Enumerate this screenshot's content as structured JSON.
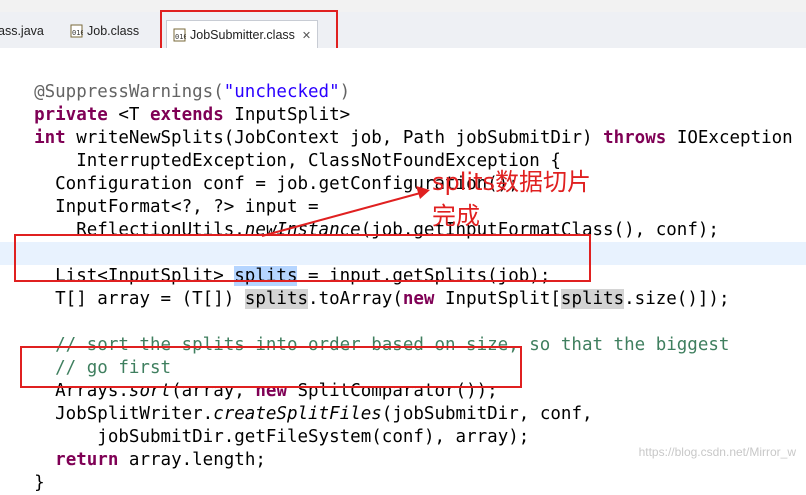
{
  "tabs": [
    {
      "label": "ass.java",
      "icon": "java-file-icon",
      "active": false
    },
    {
      "label": "Job.class",
      "icon": "class-file-icon",
      "active": false
    },
    {
      "label": "JobSubmitter.class",
      "icon": "class-file-icon",
      "active": true,
      "close": "✕"
    }
  ],
  "code": {
    "l1": [
      "@SuppressWarnings(",
      "\"unchecked\"",
      ")"
    ],
    "l2": [
      "private",
      " <T ",
      "extends",
      " InputSplit>"
    ],
    "l3": [
      "int",
      " writeNewSplits(JobContext ",
      "job",
      ", Path ",
      "jobSubmitDir",
      ") ",
      "throws",
      " IOException"
    ],
    "l4": [
      "    InterruptedException, ClassNotFoundException {"
    ],
    "l5": [
      "  Configuration ",
      "conf",
      " = ",
      "job",
      ".getConfiguration();"
    ],
    "l6": [
      "  InputFormat<?, ?> ",
      "input",
      " ="
    ],
    "l7": [
      "    ReflectionUtils.",
      "newInstance",
      "(job.getInputFormatClass(), ",
      "conf",
      ");"
    ],
    "l8": [
      "  List<InputSplit> ",
      "splits",
      " = ",
      "input",
      ".getSplits(",
      "job",
      ");"
    ],
    "l9": [
      "  T[] ",
      "array",
      " = (T[]) ",
      "splits",
      ".toArray(",
      "new",
      " InputSplit[",
      "splits",
      ".size()]);"
    ],
    "l10": [
      "  // sort the splits into order based on size, so that the biggest"
    ],
    "l11": [
      "  // go first"
    ],
    "l12": [
      "  Arrays.",
      "sort",
      "(",
      "array",
      ", ",
      "new",
      " SplitComparator());"
    ],
    "l13": [
      "  JobSplitWriter.",
      "createSplitFiles",
      "(",
      "jobSubmitDir",
      ", ",
      "conf",
      ","
    ],
    "l14": [
      "      ",
      "jobSubmitDir",
      ".getFileSystem(",
      "conf",
      "), ",
      "array",
      ");"
    ],
    "l15": [
      "  ",
      "return",
      " ",
      "array",
      ".length;"
    ],
    "l16": [
      "}"
    ]
  },
  "annotation": {
    "line1": "splits数据切片",
    "line2": "完成"
  },
  "watermark": "https://blog.csdn.net/Mirror_w",
  "colors": {
    "keyword": "#7f0055",
    "string": "#2a00ff",
    "comment": "#3f7f5f",
    "annotation_mark": "#e02020",
    "selection": "#b5d5ff",
    "current_line": "#e8f2fe"
  }
}
